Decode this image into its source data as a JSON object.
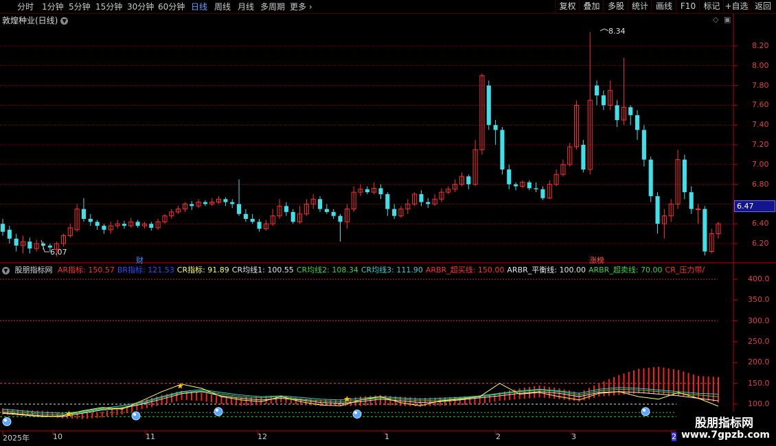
{
  "toolbar": {
    "left": [
      "分时",
      "1分钟",
      "5分钟",
      "15分钟",
      "30分钟",
      "60分钟",
      "日线",
      "周线",
      "月线",
      "多周期",
      "更多"
    ],
    "active": "日线",
    "right": [
      "复权",
      "叠加",
      "多股",
      "统计",
      "画线",
      "F10",
      "标记",
      "+自选",
      "返回"
    ]
  },
  "chart_title": "敦煌种业(日线)",
  "price_axis": [
    "8.20",
    "8.00",
    "7.80",
    "7.60",
    "7.40",
    "7.20",
    "7.00",
    "6.80",
    "6.60",
    "6.40",
    "6.20"
  ],
  "current_price": "6.47",
  "annotations": {
    "high": "8.34",
    "low": "6.07",
    "cai": "财",
    "zhangbang": "涨榜"
  },
  "indicator": {
    "name": "股朋指标网",
    "items": [
      {
        "label": "AR指标: 150.57",
        "color": "#ff3030"
      },
      {
        "label": "BR指标: 121.53",
        "color": "#2a50ff"
      },
      {
        "label": "CR指标: 91.89",
        "color": "#ffff50"
      },
      {
        "label": "CR均线1: 100.55",
        "color": "#e6e6e6"
      },
      {
        "label": "CR均线2: 108.34",
        "color": "#40d040"
      },
      {
        "label": "CR均线3: 111.90",
        "color": "#30d0d0"
      },
      {
        "label": "ARBR_超买线: 150.00",
        "color": "#ff3030"
      },
      {
        "label": "ARBR_平衡线: 100.00",
        "color": "#e6e6e6"
      },
      {
        "label": "ARBR_超卖线: 70.00",
        "color": "#40d040"
      },
      {
        "label": "CR_压力带/",
        "color": "#ff3030"
      }
    ]
  },
  "indicator_axis": [
    "400.0",
    "350.0",
    "300.0",
    "250.0",
    "200.0",
    "150.0",
    "100.0"
  ],
  "dates": [
    "2025年",
    "10",
    "11",
    "12",
    "1",
    "2",
    "3",
    "2"
  ],
  "watermark": {
    "line1": "股朋指标网",
    "line2": "www.7gpzb.com"
  },
  "colors": {
    "up": "#ff3030",
    "down": "#40e0e8",
    "axis": "#c00000"
  },
  "chart_data": {
    "type": "candlestick",
    "title": "敦煌种业(日线)",
    "y_range": [
      6.0,
      8.4
    ],
    "candles": [
      [
        6.4,
        6.32,
        6.45,
        6.28
      ],
      [
        6.34,
        6.25,
        6.38,
        6.2
      ],
      [
        6.25,
        6.18,
        6.3,
        6.12
      ],
      [
        6.18,
        6.22,
        6.28,
        6.1
      ],
      [
        6.22,
        6.15,
        6.26,
        6.1
      ],
      [
        6.15,
        6.2,
        6.24,
        6.12
      ],
      [
        6.2,
        6.18,
        6.22,
        6.14
      ],
      [
        6.18,
        6.16,
        6.2,
        6.12
      ],
      [
        6.14,
        6.2,
        6.22,
        6.07
      ],
      [
        6.2,
        6.28,
        6.3,
        6.17
      ],
      [
        6.28,
        6.36,
        6.4,
        6.26
      ],
      [
        6.34,
        6.55,
        6.6,
        6.32
      ],
      [
        6.55,
        6.45,
        6.66,
        6.42
      ],
      [
        6.45,
        6.42,
        6.5,
        6.38
      ],
      [
        6.42,
        6.38,
        6.44,
        6.34
      ],
      [
        6.38,
        6.34,
        6.4,
        6.3
      ],
      [
        6.34,
        6.38,
        6.42,
        6.3
      ],
      [
        6.38,
        6.4,
        6.44,
        6.35
      ],
      [
        6.4,
        6.38,
        6.43,
        6.35
      ],
      [
        6.38,
        6.42,
        6.46,
        6.36
      ],
      [
        6.42,
        6.38,
        6.44,
        6.36
      ],
      [
        6.38,
        6.4,
        6.42,
        6.35
      ],
      [
        6.4,
        6.36,
        6.42,
        6.33
      ],
      [
        6.36,
        6.42,
        6.45,
        6.34
      ],
      [
        6.42,
        6.48,
        6.5,
        6.4
      ],
      [
        6.48,
        6.52,
        6.55,
        6.45
      ],
      [
        6.52,
        6.55,
        6.58,
        6.5
      ],
      [
        6.55,
        6.6,
        6.62,
        6.52
      ],
      [
        6.6,
        6.58,
        6.63,
        6.54
      ],
      [
        6.58,
        6.62,
        6.65,
        6.56
      ],
      [
        6.62,
        6.6,
        6.64,
        6.58
      ],
      [
        6.6,
        6.62,
        6.66,
        6.58
      ],
      [
        6.62,
        6.65,
        6.68,
        6.6
      ],
      [
        6.65,
        6.62,
        6.67,
        6.58
      ],
      [
        6.62,
        6.6,
        6.65,
        6.56
      ],
      [
        6.6,
        6.5,
        6.85,
        6.48
      ],
      [
        6.5,
        6.45,
        6.55,
        6.42
      ],
      [
        6.45,
        6.42,
        6.5,
        6.4
      ],
      [
        6.42,
        6.35,
        6.45,
        6.32
      ],
      [
        6.35,
        6.4,
        6.44,
        6.33
      ],
      [
        6.4,
        6.48,
        6.55,
        6.38
      ],
      [
        6.48,
        6.58,
        6.65,
        6.45
      ],
      [
        6.58,
        6.52,
        6.62,
        6.48
      ],
      [
        6.52,
        6.42,
        6.55,
        6.4
      ],
      [
        6.42,
        6.5,
        6.58,
        6.4
      ],
      [
        6.5,
        6.6,
        6.65,
        6.48
      ],
      [
        6.6,
        6.65,
        6.7,
        6.55
      ],
      [
        6.65,
        6.55,
        6.68,
        6.52
      ],
      [
        6.55,
        6.52,
        6.6,
        6.5
      ],
      [
        6.52,
        6.48,
        6.55,
        6.45
      ],
      [
        6.48,
        6.42,
        6.5,
        6.22
      ],
      [
        6.42,
        6.55,
        6.6,
        6.35
      ],
      [
        6.55,
        6.72,
        6.78,
        6.52
      ],
      [
        6.72,
        6.75,
        6.8,
        6.68
      ],
      [
        6.75,
        6.72,
        6.78,
        6.7
      ],
      [
        6.72,
        6.76,
        6.82,
        6.7
      ],
      [
        6.76,
        6.7,
        6.8,
        6.65
      ],
      [
        6.7,
        6.55,
        6.72,
        6.48
      ],
      [
        6.55,
        6.48,
        6.6,
        6.45
      ],
      [
        6.48,
        6.55,
        6.58,
        6.46
      ],
      [
        6.55,
        6.6,
        6.65,
        6.5
      ],
      [
        6.6,
        6.7,
        6.72,
        6.58
      ],
      [
        6.7,
        6.62,
        6.74,
        6.58
      ],
      [
        6.62,
        6.6,
        6.66,
        6.56
      ],
      [
        6.6,
        6.65,
        6.7,
        6.58
      ],
      [
        6.65,
        6.72,
        6.76,
        6.62
      ],
      [
        6.72,
        6.75,
        6.78,
        6.7
      ],
      [
        6.75,
        6.8,
        6.85,
        6.72
      ],
      [
        6.8,
        6.88,
        6.92,
        6.78
      ],
      [
        6.88,
        6.8,
        6.9,
        6.75
      ],
      [
        6.8,
        7.15,
        7.25,
        6.78
      ],
      [
        7.15,
        7.9,
        7.92,
        7.1
      ],
      [
        7.8,
        7.4,
        7.85,
        7.35
      ],
      [
        7.4,
        7.35,
        7.45,
        7.2
      ],
      [
        7.35,
        6.95,
        7.38,
        6.9
      ],
      [
        6.95,
        6.8,
        7.0,
        6.75
      ],
      [
        6.8,
        6.78,
        6.82,
        6.74
      ],
      [
        6.78,
        6.82,
        6.84,
        6.76
      ],
      [
        6.82,
        6.76,
        6.84,
        6.74
      ],
      [
        6.76,
        6.75,
        6.82,
        6.72
      ],
      [
        6.75,
        6.66,
        6.78,
        6.64
      ],
      [
        6.66,
        6.8,
        6.84,
        6.65
      ],
      [
        6.8,
        6.9,
        6.95,
        6.78
      ],
      [
        6.9,
        7.0,
        7.05,
        6.88
      ],
      [
        7.0,
        7.18,
        7.22,
        6.98
      ],
      [
        7.18,
        7.6,
        7.65,
        7.15
      ],
      [
        7.2,
        6.95,
        7.25,
        6.92
      ],
      [
        6.95,
        7.65,
        8.34,
        6.9
      ],
      [
        7.8,
        7.7,
        7.85,
        7.6
      ],
      [
        7.7,
        7.6,
        7.75,
        7.55
      ],
      [
        7.6,
        7.75,
        7.85,
        7.55
      ],
      [
        7.6,
        7.45,
        7.65,
        7.38
      ],
      [
        7.45,
        7.58,
        8.08,
        7.4
      ],
      [
        7.58,
        7.5,
        7.6,
        7.4
      ],
      [
        7.5,
        7.35,
        7.55,
        7.25
      ],
      [
        7.35,
        7.05,
        7.4,
        6.98
      ],
      [
        7.05,
        6.68,
        7.08,
        6.62
      ],
      [
        6.68,
        6.4,
        6.72,
        6.3
      ],
      [
        6.4,
        6.48,
        6.55,
        6.25
      ],
      [
        6.48,
        6.6,
        6.65,
        6.42
      ],
      [
        6.6,
        7.05,
        7.15,
        6.55
      ],
      [
        7.05,
        6.72,
        7.1,
        6.65
      ],
      [
        6.72,
        6.55,
        6.78,
        6.5
      ],
      [
        6.55,
        6.55,
        6.6,
        6.4
      ],
      [
        6.55,
        6.12,
        6.58,
        6.08
      ],
      [
        6.12,
        6.3,
        6.35,
        6.1
      ],
      [
        6.3,
        6.4,
        6.42,
        6.25
      ]
    ]
  }
}
